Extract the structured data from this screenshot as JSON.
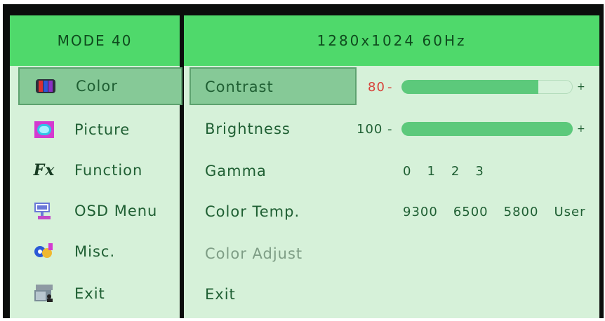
{
  "left_panel": {
    "header": "MODE 40",
    "items": [
      {
        "label": "Color",
        "icon": "color-icon",
        "selected": true
      },
      {
        "label": "Picture",
        "icon": "picture-icon"
      },
      {
        "label": "Function",
        "icon": "function-icon"
      },
      {
        "label": "OSD Menu",
        "icon": "osd-menu-icon"
      },
      {
        "label": "Misc.",
        "icon": "misc-icon"
      },
      {
        "label": "Exit",
        "icon": "exit-icon"
      }
    ]
  },
  "right_panel": {
    "header": "1280x1024 60Hz",
    "contrast": {
      "label": "Contrast",
      "value": "80",
      "dash": "-",
      "plus": "+",
      "level_percent": 80
    },
    "brightness": {
      "label": "Brightness",
      "value": "100",
      "dash": "-",
      "plus": "+",
      "level_percent": 100
    },
    "gamma": {
      "label": "Gamma",
      "options": [
        "0",
        "1",
        "2",
        "3"
      ]
    },
    "color_temp": {
      "label": "Color Temp.",
      "options": [
        "9300",
        "6500",
        "5800",
        "User"
      ]
    },
    "color_adjust": {
      "label": "Color Adjust",
      "disabled": true
    },
    "exit": {
      "label": "Exit"
    }
  },
  "colors": {
    "header_green": "#4fd96b",
    "panel_bg": "#d6f1d9",
    "selected_bg": "#86c997",
    "text_green": "#1f5f33",
    "value_red": "#d8423a",
    "slider_fill": "#5cc97b"
  }
}
